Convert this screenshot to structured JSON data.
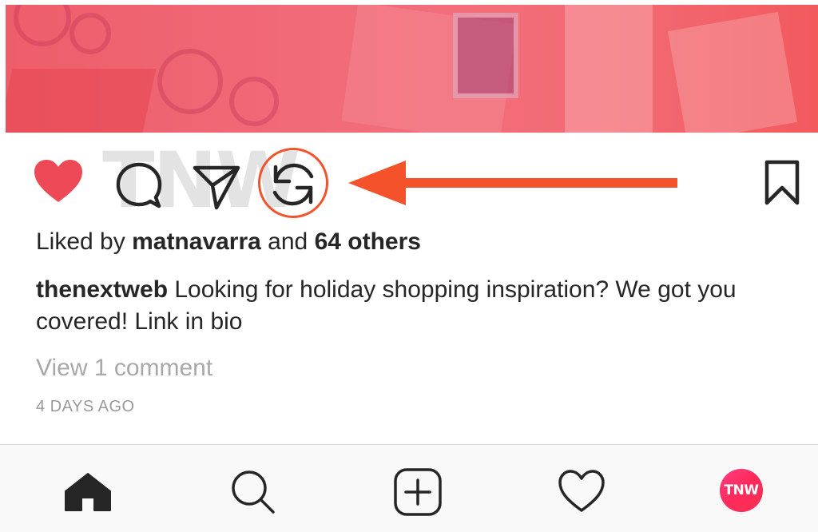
{
  "post": {
    "watermark_text": "TNW",
    "likes": {
      "prefix": "Liked by ",
      "user": "matnavarra",
      "middle": " and ",
      "count_text": "64 others"
    },
    "caption": {
      "username": "thenextweb",
      "text": " Looking for holiday shopping inspiration? We got you covered! Link in bio"
    },
    "view_comments": "View 1 comment",
    "timestamp": "4 DAYS AGO"
  },
  "actions": {
    "like_icon": "heart-filled-icon",
    "comment_icon": "comment-bubble-icon",
    "share_icon": "paper-plane-icon",
    "repost_icon": "repost-cycle-icon",
    "save_icon": "bookmark-icon",
    "like_color": "#ed4956",
    "highlight_color": "#f3522b"
  },
  "tabbar": {
    "items": [
      "home-icon",
      "search-icon",
      "add-post-icon",
      "activity-heart-icon",
      "profile-avatar"
    ],
    "avatar_text": "TNW",
    "avatar_color": "#ff2a5c"
  }
}
